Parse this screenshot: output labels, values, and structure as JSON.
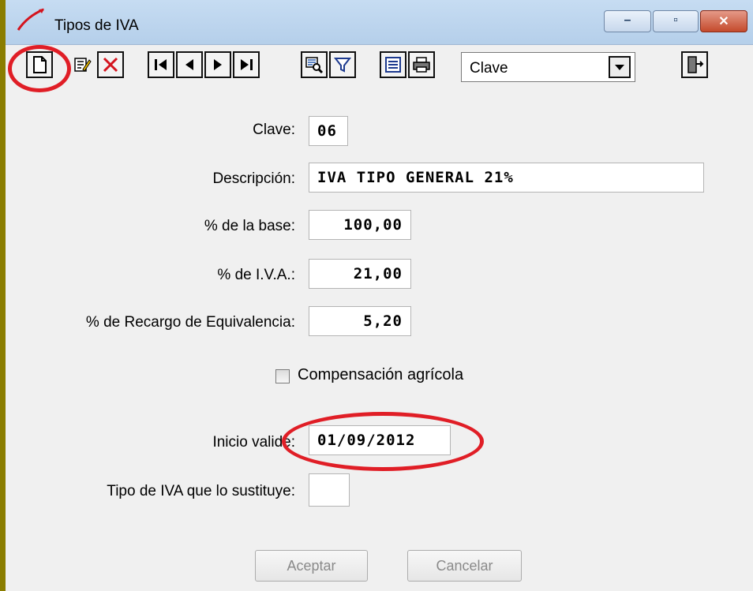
{
  "window": {
    "title": "Tipos de IVA",
    "buttons": {
      "minimize": "–",
      "maximize": "▫",
      "close": "✕"
    }
  },
  "toolbar": {
    "icons": [
      "new-record-icon",
      "edit-icon",
      "delete-icon",
      "first-record-icon",
      "previous-record-icon",
      "next-record-icon",
      "last-record-icon",
      "search-icon",
      "filter-icon",
      "list-icon",
      "print-icon",
      "exit-icon"
    ],
    "sort_combo": {
      "value": "Clave"
    }
  },
  "form": {
    "clave": {
      "label": "Clave:",
      "value": "06"
    },
    "descripcion": {
      "label": "Descripción:",
      "value": "IVA TIPO GENERAL 21%"
    },
    "pct_base": {
      "label": "% de la base:",
      "value": "100,00"
    },
    "pct_iva": {
      "label": "% de I.V.A.:",
      "value": "21,00"
    },
    "pct_recargo": {
      "label": "% de Recargo de Equivalencia:",
      "value": "5,20"
    },
    "compensacion": {
      "label": "Compensación agrícola",
      "checked": false
    },
    "inicio_validez": {
      "label": "Inicio valide:",
      "value": "01/09/2012"
    },
    "tipo_sustituye": {
      "label": "Tipo de IVA que lo sustituye:",
      "value": ""
    }
  },
  "actions": {
    "accept": "Aceptar",
    "cancel": "Cancelar"
  },
  "colors": {
    "annotation": "#e01e26",
    "window_border": "#8a7d00"
  }
}
